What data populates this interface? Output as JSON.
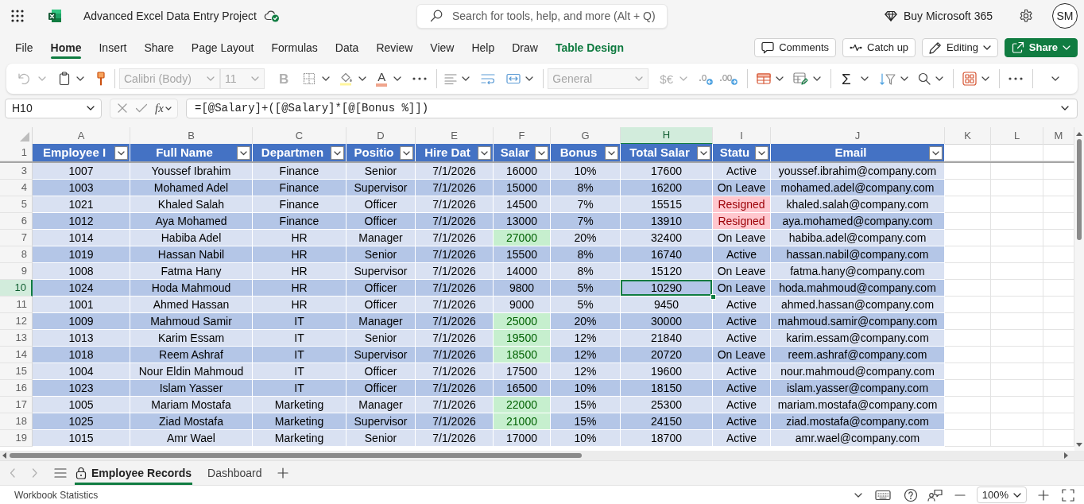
{
  "title_bar": {
    "title": "Advanced Excel Data Entry Project",
    "search": {
      "placeholder": "Search for tools, help, and more (Alt + Q)"
    },
    "buy_label": "Buy Microsoft 365",
    "avatar_initials": "SM"
  },
  "ribbon": {
    "tabs": [
      {
        "label": "File",
        "selected": false,
        "contextual": false
      },
      {
        "label": "Home",
        "selected": true,
        "contextual": false
      },
      {
        "label": "Insert",
        "selected": false,
        "contextual": false
      },
      {
        "label": "Share",
        "selected": false,
        "contextual": false
      },
      {
        "label": "Page Layout",
        "selected": false,
        "contextual": false
      },
      {
        "label": "Formulas",
        "selected": false,
        "contextual": false
      },
      {
        "label": "Data",
        "selected": false,
        "contextual": false
      },
      {
        "label": "Review",
        "selected": false,
        "contextual": false
      },
      {
        "label": "View",
        "selected": false,
        "contextual": false
      },
      {
        "label": "Help",
        "selected": false,
        "contextual": false
      },
      {
        "label": "Draw",
        "selected": false,
        "contextual": false
      },
      {
        "label": "Table Design",
        "selected": false,
        "contextual": true
      }
    ],
    "comments_label": "Comments",
    "catch_up_label": "Catch up",
    "editing_label": "Editing",
    "share_label": "Share"
  },
  "toolbar": {
    "undo": {
      "disabled": true
    },
    "font_family": {
      "value": "Calibri (Body)",
      "disabled": true
    },
    "font_size": {
      "value": "11",
      "disabled": true
    },
    "bold": {
      "label": "B",
      "disabled": true
    },
    "font_color": {
      "label": "A"
    },
    "number_format": {
      "value": "General",
      "disabled": true
    },
    "currency": {
      "label": "$€",
      "disabled": true
    },
    "autosum": {
      "label": "Σ"
    }
  },
  "formula_bar": {
    "name_box": "H10",
    "function_label": "fx",
    "formula": "=[@Salary]+([@Salary]*[@[Bonus %]])"
  },
  "sheet": {
    "columns": [
      {
        "letter": "A",
        "header": "Employee I",
        "selected": false
      },
      {
        "letter": "B",
        "header": "Full Name",
        "selected": false
      },
      {
        "letter": "C",
        "header": "Departmen",
        "selected": false
      },
      {
        "letter": "D",
        "header": "Positio",
        "selected": false
      },
      {
        "letter": "E",
        "header": "Hire Dat",
        "selected": false
      },
      {
        "letter": "F",
        "header": "Salar",
        "selected": false
      },
      {
        "letter": "G",
        "header": "Bonus",
        "selected": false
      },
      {
        "letter": "H",
        "header": "Total Salar",
        "selected": true
      },
      {
        "letter": "I",
        "header": "Statu",
        "selected": false
      },
      {
        "letter": "J",
        "header": "Email",
        "selected": false
      },
      {
        "letter": "K",
        "selected": false
      },
      {
        "letter": "L",
        "selected": false
      },
      {
        "letter": "M",
        "selected": false
      }
    ],
    "header_row_number": "1",
    "rows": [
      {
        "number": "3",
        "selected": false,
        "salary_high": false,
        "status_alert": false,
        "cells": [
          "1007",
          "Youssef Ibrahim",
          "Finance",
          "Senior",
          "7/1/2026",
          "16000",
          "10%",
          "17600",
          "Active",
          "youssef.ibrahim@company.com"
        ]
      },
      {
        "number": "4",
        "selected": false,
        "salary_high": false,
        "status_alert": false,
        "cells": [
          "1003",
          "Mohamed Adel",
          "Finance",
          "Supervisor",
          "7/1/2026",
          "15000",
          "8%",
          "16200",
          "On Leave",
          "mohamed.adel@company.com"
        ]
      },
      {
        "number": "5",
        "selected": false,
        "salary_high": false,
        "status_alert": true,
        "cells": [
          "1021",
          "Khaled Salah",
          "Finance",
          "Officer",
          "7/1/2026",
          "14500",
          "7%",
          "15515",
          "Resigned",
          "khaled.salah@company.com"
        ]
      },
      {
        "number": "6",
        "selected": false,
        "salary_high": false,
        "status_alert": true,
        "cells": [
          "1012",
          "Aya Mohamed",
          "Finance",
          "Officer",
          "7/1/2026",
          "13000",
          "7%",
          "13910",
          "Resigned",
          "aya.mohamed@company.com"
        ]
      },
      {
        "number": "7",
        "selected": false,
        "salary_high": true,
        "status_alert": false,
        "cells": [
          "1014",
          "Habiba Adel",
          "HR",
          "Manager",
          "7/1/2026",
          "27000",
          "20%",
          "32400",
          "On Leave",
          "habiba.adel@company.com"
        ]
      },
      {
        "number": "8",
        "selected": false,
        "salary_high": false,
        "status_alert": false,
        "cells": [
          "1019",
          "Hassan Nabil",
          "HR",
          "Senior",
          "7/1/2026",
          "15500",
          "8%",
          "16740",
          "Active",
          "hassan.nabil@company.com"
        ]
      },
      {
        "number": "9",
        "selected": false,
        "salary_high": false,
        "status_alert": false,
        "cells": [
          "1008",
          "Fatma Hany",
          "HR",
          "Supervisor",
          "7/1/2026",
          "14000",
          "8%",
          "15120",
          "On Leave",
          "fatma.hany@company.com"
        ]
      },
      {
        "number": "10",
        "selected": true,
        "salary_high": false,
        "status_alert": false,
        "cells": [
          "1024",
          "Hoda Mahmoud",
          "HR",
          "Officer",
          "7/1/2026",
          "9800",
          "5%",
          "10290",
          "On Leave",
          "hoda.mahmoud@company.com"
        ]
      },
      {
        "number": "11",
        "selected": false,
        "salary_high": false,
        "status_alert": false,
        "cells": [
          "1001",
          "Ahmed Hassan",
          "HR",
          "Officer",
          "7/1/2026",
          "9000",
          "5%",
          "9450",
          "Active",
          "ahmed.hassan@company.com"
        ]
      },
      {
        "number": "12",
        "selected": false,
        "salary_high": true,
        "status_alert": false,
        "cells": [
          "1009",
          "Mahmoud Samir",
          "IT",
          "Manager",
          "7/1/2026",
          "25000",
          "20%",
          "30000",
          "Active",
          "mahmoud.samir@company.com"
        ]
      },
      {
        "number": "13",
        "selected": false,
        "salary_high": true,
        "status_alert": false,
        "cells": [
          "1013",
          "Karim Essam",
          "IT",
          "Senior",
          "7/1/2026",
          "19500",
          "12%",
          "21840",
          "Active",
          "karim.essam@company.com"
        ]
      },
      {
        "number": "14",
        "selected": false,
        "salary_high": true,
        "status_alert": false,
        "cells": [
          "1018",
          "Reem Ashraf",
          "IT",
          "Supervisor",
          "7/1/2026",
          "18500",
          "12%",
          "20720",
          "On Leave",
          "reem.ashraf@company.com"
        ]
      },
      {
        "number": "15",
        "selected": false,
        "salary_high": false,
        "status_alert": false,
        "cells": [
          "1004",
          "Nour Eldin Mahmoud",
          "IT",
          "Officer",
          "7/1/2026",
          "17500",
          "12%",
          "19600",
          "Active",
          "nour.mahmoud@company.com"
        ]
      },
      {
        "number": "16",
        "selected": false,
        "salary_high": false,
        "status_alert": false,
        "cells": [
          "1023",
          "Islam Yasser",
          "IT",
          "Officer",
          "7/1/2026",
          "16500",
          "10%",
          "18150",
          "Active",
          "islam.yasser@company.com"
        ]
      },
      {
        "number": "17",
        "selected": false,
        "salary_high": true,
        "status_alert": false,
        "cells": [
          "1005",
          "Mariam Mostafa",
          "Marketing",
          "Manager",
          "7/1/2026",
          "22000",
          "15%",
          "25300",
          "Active",
          "mariam.mostafa@company.com"
        ]
      },
      {
        "number": "18",
        "selected": false,
        "salary_high": true,
        "status_alert": false,
        "cells": [
          "1025",
          "Ziad Mostafa",
          "Marketing",
          "Supervisor",
          "7/1/2026",
          "21000",
          "15%",
          "24150",
          "Active",
          "ziad.mostafa@company.com"
        ]
      },
      {
        "number": "19",
        "selected": false,
        "salary_high": false,
        "status_alert": false,
        "cells": [
          "1015",
          "Amr Wael",
          "Marketing",
          "Senior",
          "7/1/2026",
          "17000",
          "10%",
          "18700",
          "Active",
          "amr.wael@company.com"
        ]
      }
    ]
  },
  "sheet_tabs": [
    {
      "label": "Employee Records",
      "selected": true,
      "protected": true
    },
    {
      "label": "Dashboard",
      "selected": false,
      "protected": false
    }
  ],
  "status_bar": {
    "label": "Workbook Statistics",
    "zoom": "100%"
  }
}
